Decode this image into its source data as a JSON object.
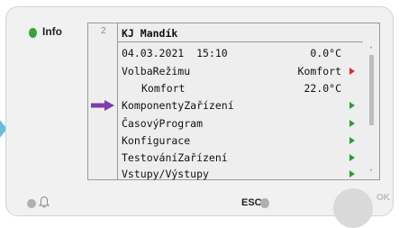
{
  "panel": {
    "info_label": "Info",
    "esc_label": "ESC",
    "ok_label": "OK",
    "led_color": "#3aa23a",
    "icons": [
      "bell-icon",
      "left-nav-arrow-icon",
      "selection-arrow-icon"
    ]
  },
  "screen": {
    "page_number": "2",
    "title": "KJ Mandík",
    "date": "04.03.2021",
    "time": "15:10",
    "temperature": "0.0°C",
    "rows": [
      {
        "label": "VolbaRežimu",
        "value": "Komfort",
        "arrow": "red"
      },
      {
        "label": "Komfort",
        "value": "22.0°C"
      },
      {
        "label": "KomponentyZařízení",
        "arrow": "green",
        "selected": true
      },
      {
        "label": "ČasovýProgram",
        "arrow": "green"
      },
      {
        "label": "Konfigurace",
        "arrow": "green"
      },
      {
        "label": "TestováníZařízení",
        "arrow": "green"
      },
      {
        "label": "Vstupy/Výstupy",
        "arrow": "green"
      }
    ],
    "scroll_up_glyph": "˄",
    "scroll_down_glyph": "˅"
  }
}
